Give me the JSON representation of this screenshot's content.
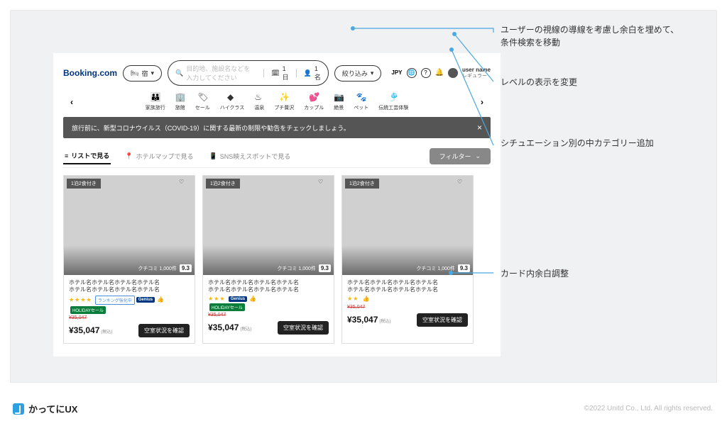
{
  "brand": "Booking.com",
  "topbar": {
    "stay_label": "宿",
    "search_placeholder": "目的地、施設名などを入力してください",
    "date_label": "1日",
    "guests_label": "1名",
    "filter_label": "絞り込み",
    "currency_label": "JPY",
    "user": {
      "name": "user name",
      "level": "レギュラー"
    }
  },
  "categories": {
    "items": [
      {
        "icon": "family",
        "label": "家族旅行"
      },
      {
        "icon": "building",
        "label": "旅館"
      },
      {
        "icon": "sale",
        "label": "セール"
      },
      {
        "icon": "diamond",
        "label": "ハイクラス"
      },
      {
        "icon": "onsen",
        "label": "温泉"
      },
      {
        "icon": "luxury",
        "label": "プチ贅沢"
      },
      {
        "icon": "couple",
        "label": "カップル"
      },
      {
        "icon": "camera",
        "label": "絶景"
      },
      {
        "icon": "paw",
        "label": "ペット"
      },
      {
        "icon": "craft",
        "label": "伝統工芸体験"
      }
    ]
  },
  "banner": "旅行前に、新型コロナウイルス（COVID-19）に関する最新の制限や勧告をチェックしましょう。",
  "view_tabs": {
    "list": "リストで見る",
    "map": "ホテルマップで見る",
    "sns": "SNS映えスポットで見る",
    "filter_btn": "フィルター"
  },
  "cards": [
    {
      "meal_badge": "1泊2食付き",
      "review_count": "クチコミ 1,000件",
      "score": "9.3",
      "name_line1": "ホテル名ホテル名ホテル名ホテル名",
      "name_line2": "ホテル名ホテル名ホテル名ホテル名",
      "stars": 4,
      "rank_tag": "ランキング強化中",
      "genius": true,
      "holiday_tag": "HOLIDAYセール",
      "strike_price": "¥35,047",
      "price": "¥35,047",
      "tax": "(税込)",
      "cta": "空室状況を確認"
    },
    {
      "meal_badge": "1泊2食付き",
      "review_count": "クチコミ 1,000件",
      "score": "9.3",
      "name_line1": "ホテル名ホテル名ホテル名ホテル名",
      "name_line2": "ホテル名ホテル名ホテル名ホテル名",
      "stars": 3,
      "rank_tag": "",
      "genius": true,
      "holiday_tag": "HOLIDAYセール",
      "strike_price": "¥35,047",
      "price": "¥35,047",
      "tax": "(税込)",
      "cta": "空室状況を確認"
    },
    {
      "meal_badge": "1泊2食付き",
      "review_count": "クチコミ 1,000件",
      "score": "9.3",
      "name_line1": "ホテル名ホテル名ホテル名ホテル名",
      "name_line2": "ホテル名ホテル名ホテル名ホテル名",
      "stars": 2,
      "rank_tag": "",
      "genius": false,
      "holiday_tag": "",
      "strike_price": "¥35,047",
      "price": "¥35,047",
      "tax": "(税込)",
      "cta": "空室状況を確認"
    }
  ],
  "annotations": {
    "a1": "ユーザーの視線の導線を考慮し余白を埋めて、条件検索を移動",
    "a2": "レベルの表示を変更",
    "a3": "シチュエーション別の中カテゴリー追加",
    "a4": "カード内余白調整"
  },
  "footer_brand": "かってにUX",
  "copyright": "©2022 Unitd Co., Ltd. All rights reserved."
}
